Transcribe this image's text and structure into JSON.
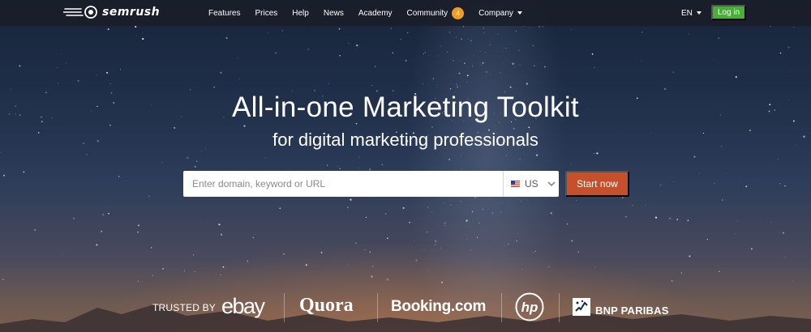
{
  "brand": {
    "logo_text": "semrush"
  },
  "nav": {
    "links": [
      {
        "label": "Features"
      },
      {
        "label": "Prices"
      },
      {
        "label": "Help"
      },
      {
        "label": "News"
      },
      {
        "label": "Academy"
      },
      {
        "label": "Community",
        "badge": "4"
      },
      {
        "label": "Company"
      }
    ],
    "language": "EN",
    "login_label": "Log in"
  },
  "hero": {
    "headline": "All-in-one Marketing Toolkit",
    "subheadline": "for digital marketing professionals",
    "search": {
      "placeholder": "Enter domain, keyword or URL",
      "value": "",
      "database": "US"
    },
    "cta_label": "Start now"
  },
  "trusted": {
    "label": "TRUSTED BY",
    "logos": [
      {
        "name": "ebay",
        "text": "ebay"
      },
      {
        "name": "quora",
        "text": "Quora"
      },
      {
        "name": "booking",
        "text": "Booking.com"
      },
      {
        "name": "hp",
        "text": "hp"
      },
      {
        "name": "bnp-paribas",
        "text": "BNP PARIBAS"
      }
    ]
  },
  "colors": {
    "login_green": "#45b035",
    "cta_orange": "#c6502b",
    "badge_orange": "#f39c23",
    "navbar_bg": "#191e28"
  }
}
